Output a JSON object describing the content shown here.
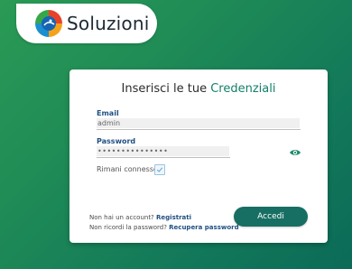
{
  "brand": {
    "name": "Soluzioni",
    "logo_icon": "colorful-circle-logo-icon",
    "colors": {
      "background_green": "#1f8b56",
      "accent_teal": "#14806a",
      "button": "#176f63",
      "link_blue": "#1f4f82"
    }
  },
  "login": {
    "title_prefix": "Inserisci le tue",
    "title_accent": "Credenziali",
    "email_label": "Email",
    "email_value": "admin",
    "password_label": "Password",
    "password_value": "•••••••••••••••",
    "show_password_icon": "eye-icon",
    "remember_label": "Rimani connesso",
    "remember_checked": true,
    "no_account_text": "Non hai un account?",
    "register_link": "Registrati",
    "forgot_text": "Non ricordi la password?",
    "recover_link": "Recupera password",
    "submit_label": "Accedi"
  }
}
